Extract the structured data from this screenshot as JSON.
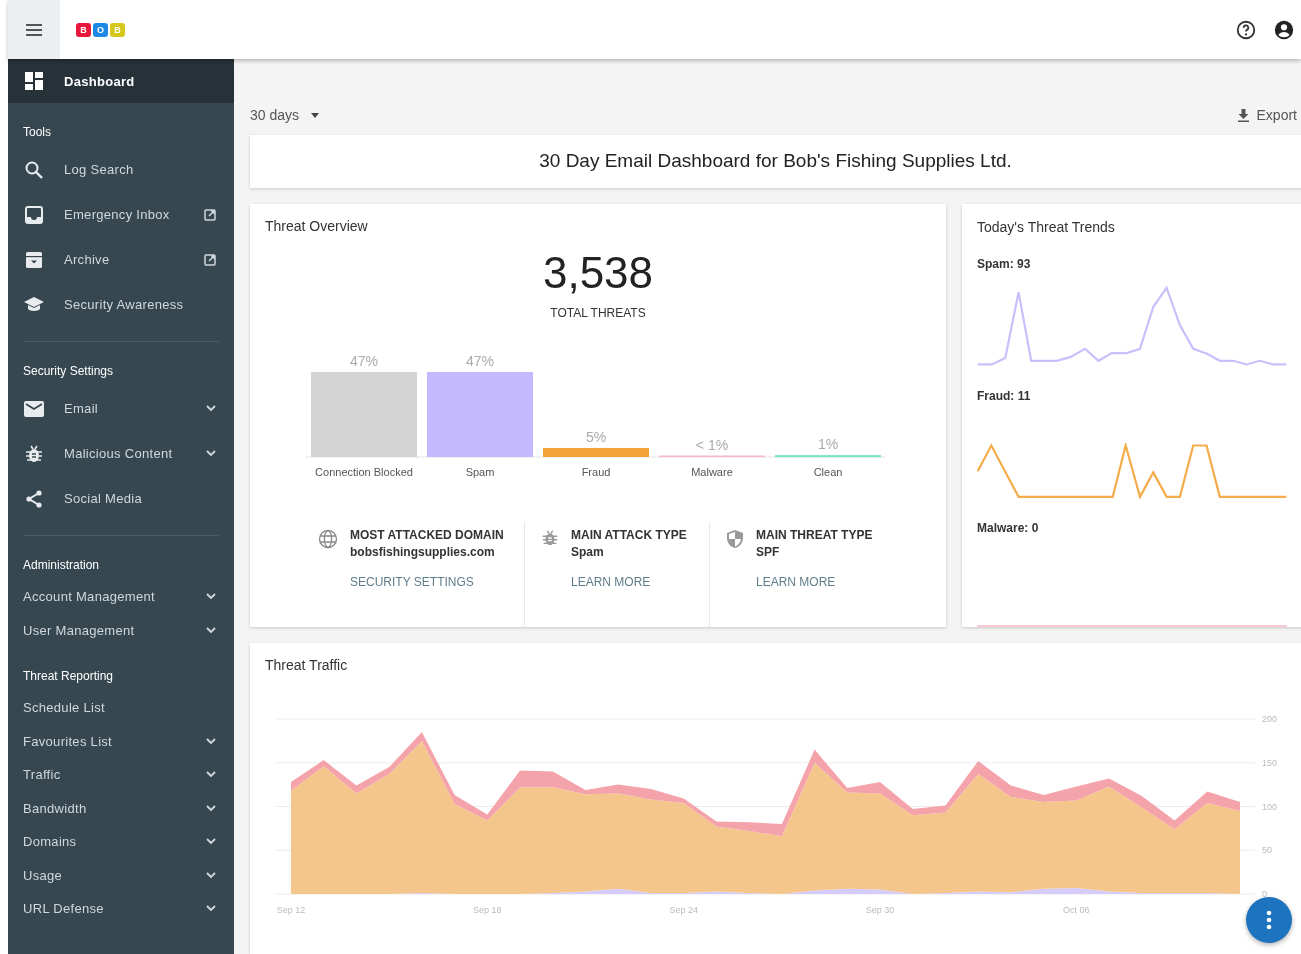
{
  "header": {
    "logo_letters": [
      "B",
      "O",
      "B"
    ]
  },
  "sidebar": {
    "top_item": {
      "label": "Dashboard",
      "selected": true
    },
    "sections": [
      {
        "title": "Tools",
        "divider_after": true,
        "items": [
          {
            "label": "Log Search",
            "external": false,
            "expandable": false
          },
          {
            "label": "Emergency Inbox",
            "external": true,
            "expandable": false
          },
          {
            "label": "Archive",
            "external": true,
            "expandable": false
          },
          {
            "label": "Security Awareness",
            "external": false,
            "expandable": false
          }
        ]
      },
      {
        "title": "Security Settings",
        "divider_after": true,
        "items": [
          {
            "label": "Email",
            "external": false,
            "expandable": true
          },
          {
            "label": "Malicious Content",
            "external": false,
            "expandable": true
          },
          {
            "label": "Social Media",
            "external": false,
            "expandable": false
          }
        ]
      },
      {
        "title": "Administration",
        "divider_after": false,
        "items": [
          {
            "label": "Account Management",
            "external": false,
            "expandable": true
          },
          {
            "label": "User Management",
            "external": false,
            "expandable": true
          }
        ]
      },
      {
        "title": "Threat Reporting",
        "divider_after": false,
        "items": [
          {
            "label": "Schedule List",
            "external": false,
            "expandable": false
          },
          {
            "label": "Favourites List",
            "external": false,
            "expandable": true
          },
          {
            "label": "Traffic",
            "external": false,
            "expandable": true
          },
          {
            "label": "Bandwidth",
            "external": false,
            "expandable": true
          },
          {
            "label": "Domains",
            "external": false,
            "expandable": true
          },
          {
            "label": "Usage",
            "external": false,
            "expandable": true
          },
          {
            "label": "URL Defense",
            "external": false,
            "expandable": true
          }
        ]
      }
    ]
  },
  "toolbar": {
    "period": "30 days",
    "export": "Export"
  },
  "page_title": "30 Day Email Dashboard for Bob's Fishing Supplies Ltd.",
  "threat_overview": {
    "title": "Threat Overview",
    "total": "3,538",
    "total_label": "TOTAL THREATS",
    "chart_data": {
      "type": "bar",
      "categories": [
        "Connection Blocked",
        "Spam",
        "Fraud",
        "Malware",
        "Clean"
      ],
      "values": [
        47,
        47,
        5,
        0.5,
        1
      ],
      "value_labels": [
        "47%",
        "47%",
        "5%",
        "< 1%",
        "1%"
      ],
      "colors": [
        "#d4d4d4",
        "#c3b9fc",
        "#f2a33a",
        "#f7b8c4",
        "#6fe0c4"
      ]
    },
    "stats": [
      {
        "label": "MOST ATTACKED DOMAIN",
        "value": "bobsfishingsupplies.com",
        "link": "SECURITY SETTINGS"
      },
      {
        "label": "MAIN ATTACK TYPE",
        "value": "Spam",
        "link": "LEARN MORE"
      },
      {
        "label": "MAIN THREAT TYPE",
        "value": "SPF",
        "link": "LEARN MORE"
      }
    ]
  },
  "threat_trends": {
    "title": "Today's Threat Trends",
    "trends": [
      {
        "label": "Spam: 93",
        "kind": "spam"
      },
      {
        "label": "Fraud: 11",
        "kind": "fraud"
      },
      {
        "label": "Malware: 0",
        "kind": "flat"
      }
    ]
  },
  "threat_traffic": {
    "title": "Threat Traffic",
    "chart_data": {
      "type": "area",
      "stacked": true,
      "grid": true,
      "categories": [
        "Sep 12",
        null,
        null,
        null,
        null,
        null,
        "Sep 18",
        null,
        null,
        null,
        null,
        null,
        "Sep 24",
        null,
        null,
        null,
        null,
        null,
        "Sep 30",
        null,
        null,
        null,
        null,
        null,
        "Oct 06",
        null,
        null,
        null,
        null,
        null
      ],
      "ylim": [
        0,
        200
      ],
      "yticks": [
        0,
        50,
        100,
        150,
        200
      ],
      "series": [
        {
          "color": "#d6ccfb",
          "values": [
            0,
            0,
            0,
            0,
            1,
            0,
            0,
            0,
            1,
            3,
            6,
            1,
            1,
            3,
            1,
            0,
            4,
            6,
            5,
            0,
            1,
            3,
            2,
            6,
            7,
            3,
            1,
            1,
            1,
            0
          ]
        },
        {
          "color": "#f5c68c",
          "values": [
            118,
            146,
            115,
            137,
            174,
            103,
            84,
            122,
            121,
            111,
            109,
            107,
            103,
            74,
            71,
            66,
            146,
            110,
            110,
            90,
            92,
            134,
            109,
            99,
            100,
            120,
            98,
            73,
            103,
            95
          ]
        },
        {
          "color": "#f4a3ab",
          "values": [
            10,
            7,
            9,
            8,
            10,
            10,
            7,
            19,
            18,
            5,
            10,
            12,
            5,
            6,
            10,
            14,
            15,
            5,
            13,
            7,
            8,
            15,
            13,
            8,
            16,
            9,
            13,
            10,
            13,
            10
          ]
        }
      ]
    }
  }
}
